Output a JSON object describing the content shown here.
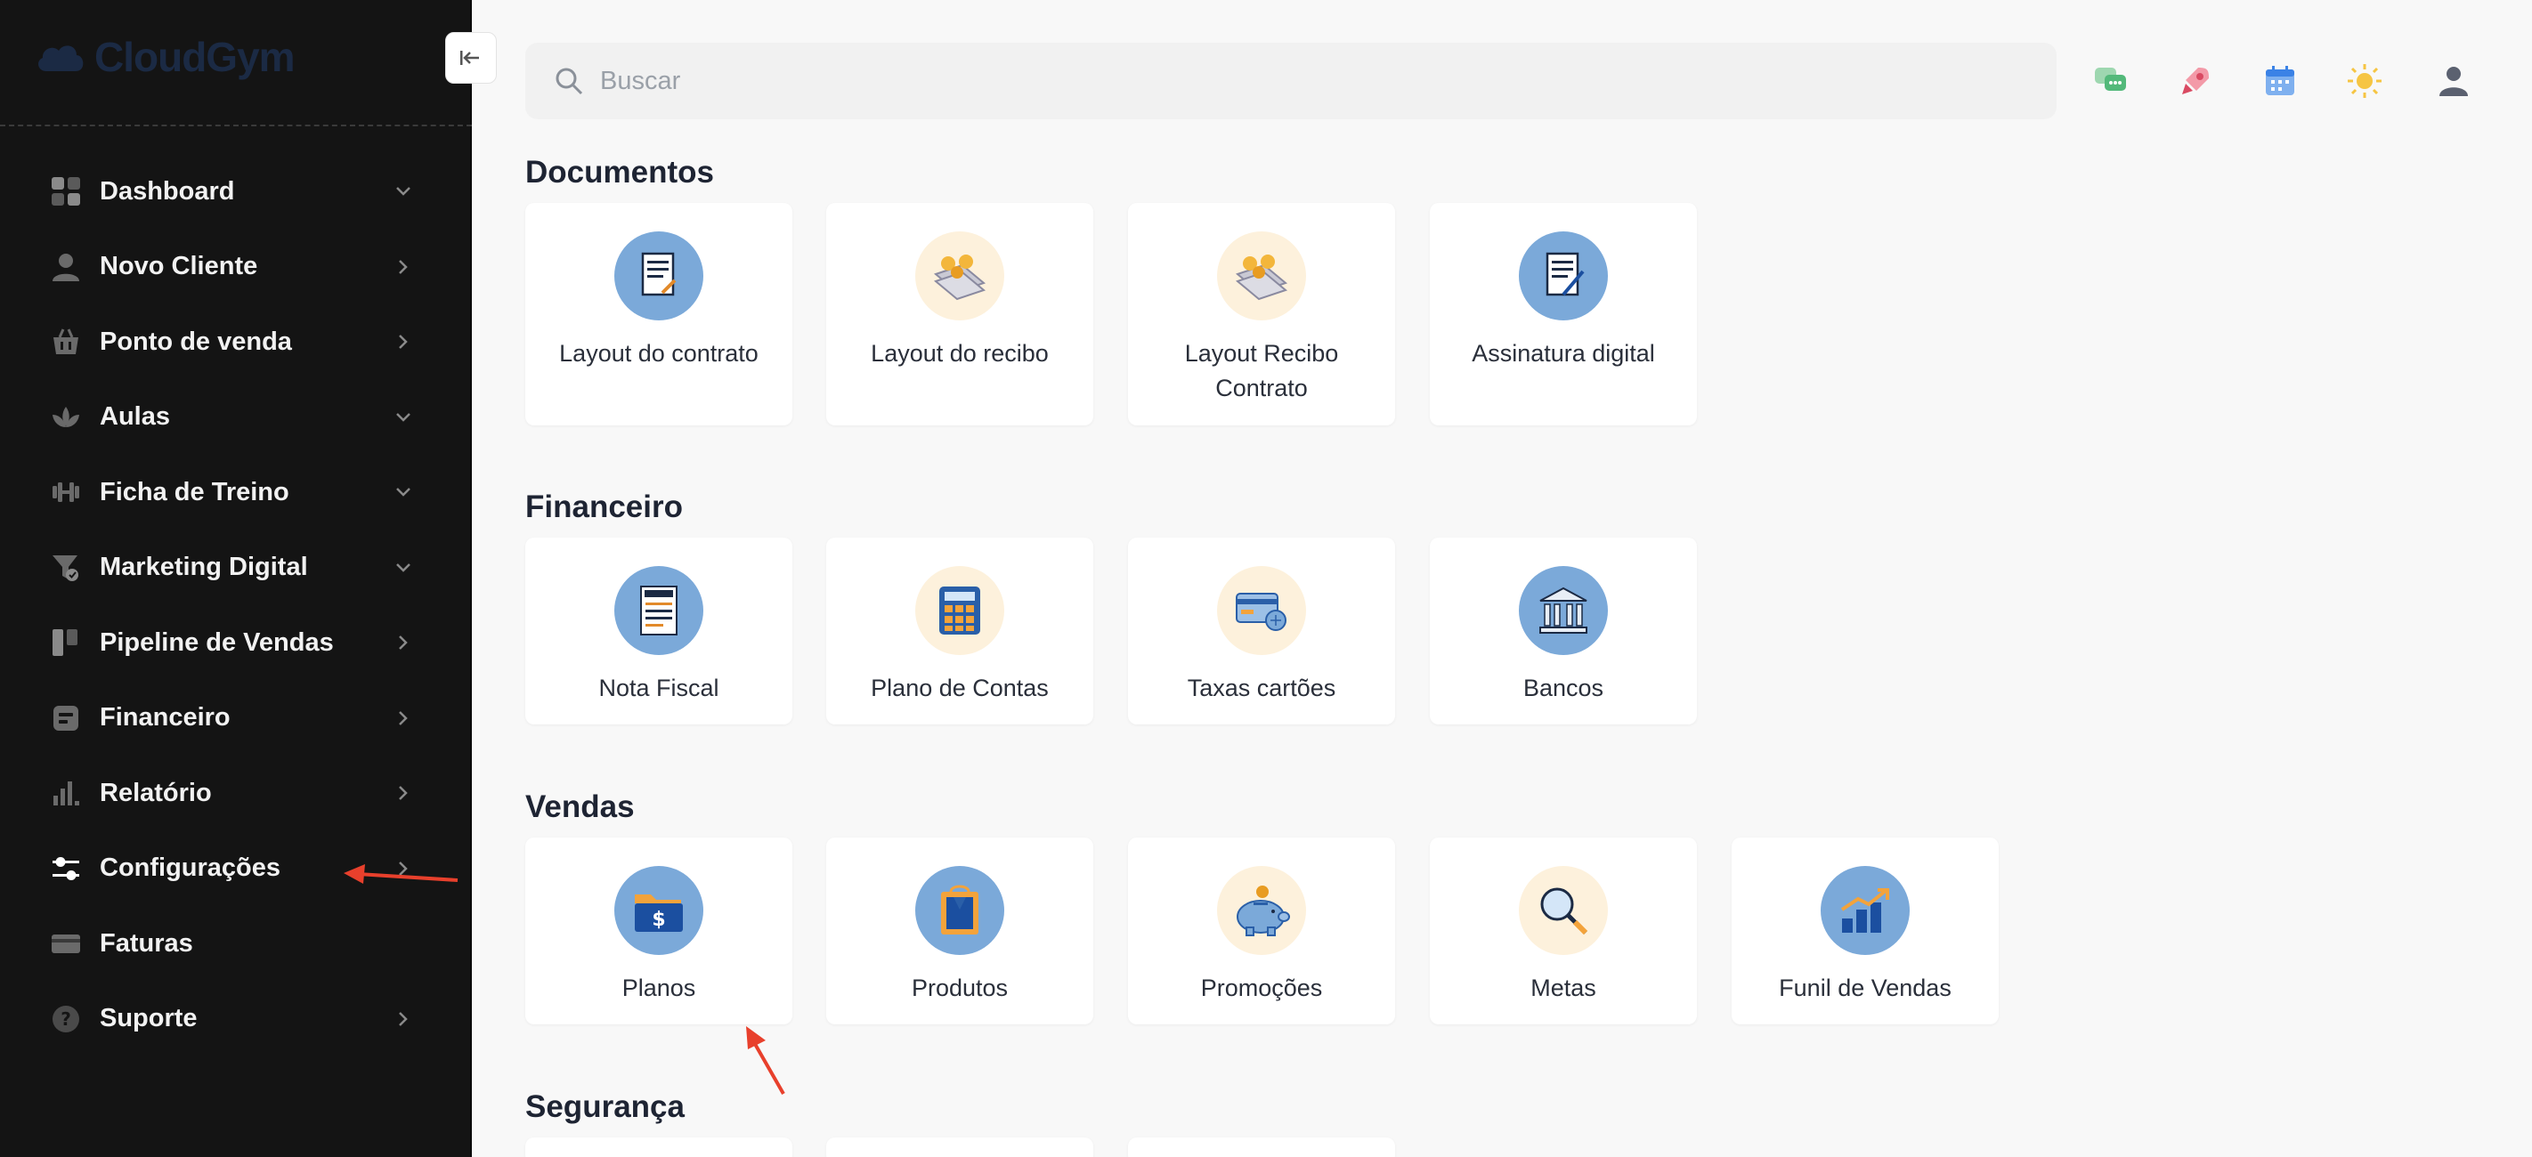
{
  "app": {
    "name": "CloudGym",
    "brand_color": "#1b2a44"
  },
  "sidebar": {
    "items": [
      {
        "label": "Dashboard",
        "icon": "dashboard-grid-icon",
        "chevron": "down"
      },
      {
        "label": "Novo Cliente",
        "icon": "user-icon",
        "chevron": "right"
      },
      {
        "label": "Ponto de venda",
        "icon": "basket-icon",
        "chevron": "right"
      },
      {
        "label": "Aulas",
        "icon": "lotus-icon",
        "chevron": "down"
      },
      {
        "label": "Ficha de Treino",
        "icon": "dumbbell-icon",
        "chevron": "down"
      },
      {
        "label": "Marketing Digital",
        "icon": "funnel-check-icon",
        "chevron": "down"
      },
      {
        "label": "Pipeline de Vendas",
        "icon": "pipeline-icon",
        "chevron": "right"
      },
      {
        "label": "Financeiro",
        "icon": "wallet-icon",
        "chevron": "right"
      },
      {
        "label": "Relatório",
        "icon": "bar-chart-icon",
        "chevron": "right"
      },
      {
        "label": "Configurações",
        "icon": "sliders-icon",
        "chevron": "right"
      },
      {
        "label": "Faturas",
        "icon": "credit-card-icon",
        "chevron": "none"
      },
      {
        "label": "Suporte",
        "icon": "help-circle-icon",
        "chevron": "right"
      }
    ]
  },
  "search": {
    "placeholder": "Buscar"
  },
  "top_icons": [
    "chat-icon",
    "rocket-icon",
    "calendar-icon",
    "sun-icon",
    "profile-icon"
  ],
  "sections": {
    "documentos": {
      "title": "Documentos",
      "cards": [
        "Layout do contrato",
        "Layout do recibo",
        "Layout Recibo Contrato",
        "Assinatura digital"
      ]
    },
    "financeiro": {
      "title": "Financeiro",
      "cards": [
        "Nota Fiscal",
        "Plano de Contas",
        "Taxas cartões",
        "Bancos"
      ]
    },
    "vendas": {
      "title": "Vendas",
      "cards": [
        "Planos",
        "Produtos",
        "Promoções",
        "Metas",
        "Funil de Vendas"
      ]
    },
    "seguranca": {
      "title": "Segurança"
    }
  },
  "colors": {
    "accent_blue": "#7ba9d9",
    "cream": "#fdf1dc",
    "annotation_red": "#e8402c"
  }
}
